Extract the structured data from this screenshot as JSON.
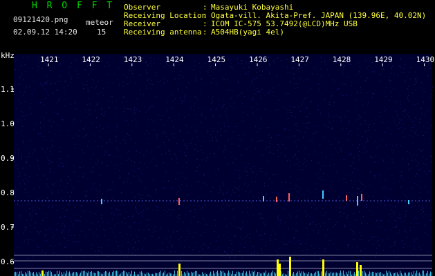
{
  "app": {
    "title": "H R O F F T",
    "filename": "09121420.png",
    "datetime": "02.09.12 14:20",
    "counter_label": "meteor",
    "counter_value": "15"
  },
  "info": {
    "rows": [
      {
        "label": "Observer",
        "sep": ":",
        "value": "Masayuki Kobayashi"
      },
      {
        "label": "Receiving Location",
        "sep": ":",
        "value": "Ogata-vill. Akita-Pref. JAPAN (139.96E, 40.02N)"
      },
      {
        "label": "Receiver",
        "sep": ":",
        "value": "ICOM IC-575 53.7492(@LCD)MHz USB"
      },
      {
        "label": "Receiving antenna",
        "sep": ":",
        "value": "A504HB(yagi 4el)"
      }
    ]
  },
  "spectrogram": {
    "y_unit": "kHz",
    "y_ticks": [
      "1.1",
      "1.0",
      "0.9",
      "0.8",
      "0.7",
      "0.6"
    ],
    "x_ticks": [
      "1421",
      "1422",
      "1423",
      "1424",
      "1425",
      "1426",
      "1427",
      "1428",
      "1429",
      "1430"
    ],
    "colors": {
      "background": "#000030",
      "noise": "#1a1a7a",
      "signal_line": "#5a6cff",
      "hit": "#ff6060",
      "hit_alt": "#40d0ff",
      "lower_bar": "#40e0ff",
      "peak": "#ffff00",
      "tick_text": "#ffffff",
      "grid": "#8080a0"
    }
  }
}
